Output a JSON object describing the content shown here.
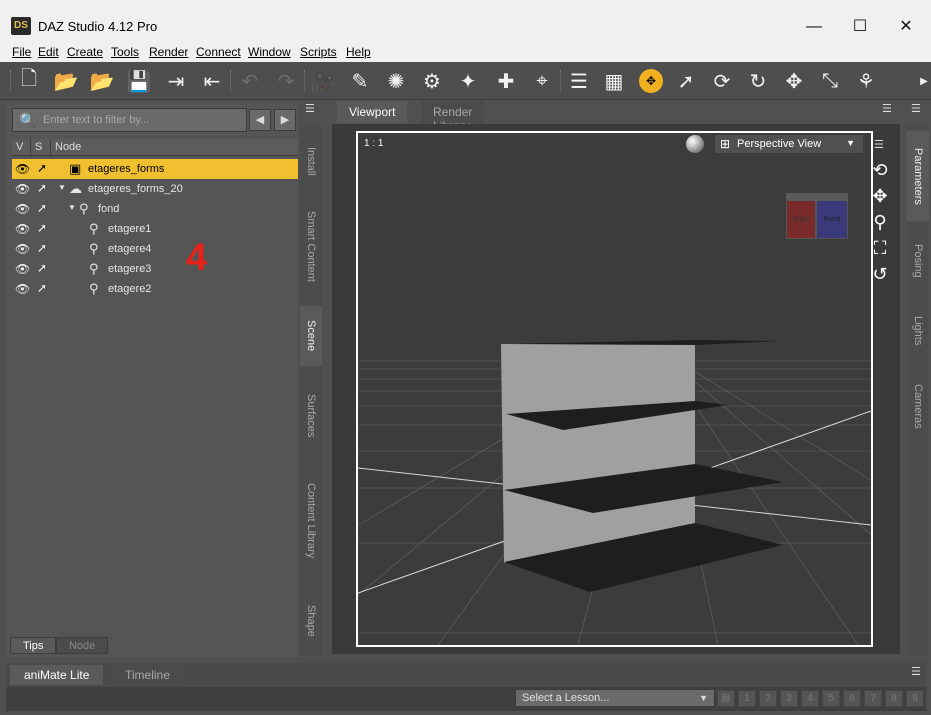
{
  "window": {
    "title": "DAZ Studio 4.12 Pro",
    "icon_text": "DS",
    "minimize": "—",
    "maximize": "☐",
    "close": "✕"
  },
  "menu": [
    "File",
    "Edit",
    "Create",
    "Tools",
    "Render",
    "Connect",
    "Window",
    "Scripts",
    "Help"
  ],
  "toolbar": {
    "icons": [
      "new-icon",
      "open-icon",
      "merge-icon",
      "save-icon",
      "import-icon",
      "export-icon",
      "undo-icon",
      "redo-icon",
      "scene-tool-icon",
      "spot-render-icon",
      "render-icon",
      "render-settings-icon",
      "light-icon",
      "camera-icon",
      "node-tool-icon",
      "align-icon",
      "grid-icon",
      "universal-tool-icon",
      "node-selection-icon",
      "transform-icon",
      "rotate-icon",
      "translate-icon",
      "scale-icon",
      "joint-editor-icon",
      "more-icon"
    ]
  },
  "scene_pane": {
    "filter_placeholder": "Enter text to filter by...",
    "columns": {
      "v": "V",
      "s": "S",
      "node": "Node"
    },
    "nodes": [
      {
        "label": "etageres_forms",
        "level": 0,
        "selected": true,
        "type": "object",
        "expanded": null
      },
      {
        "label": "etageres_forms_20",
        "level": 0,
        "selected": false,
        "type": "figure",
        "expanded": true
      },
      {
        "label": "fond",
        "level": 1,
        "selected": false,
        "type": "bone",
        "expanded": true
      },
      {
        "label": "etagere1",
        "level": 2,
        "selected": false,
        "type": "bone",
        "expanded": null
      },
      {
        "label": "etagere4",
        "level": 2,
        "selected": false,
        "type": "bone",
        "expanded": null
      },
      {
        "label": "etagere3",
        "level": 2,
        "selected": false,
        "type": "bone",
        "expanded": null
      },
      {
        "label": "etagere2",
        "level": 2,
        "selected": false,
        "type": "bone",
        "expanded": null
      }
    ],
    "annotation": "4",
    "bottom_tabs": [
      "Tips",
      "Node"
    ]
  },
  "left_side_tabs": [
    "Install",
    "Smart Content",
    "Scene",
    "Surfaces",
    "Content Library",
    "Shape"
  ],
  "left_side_active": "Scene",
  "right_side_tabs": [
    "Parameters",
    "Posing",
    "Lights",
    "Cameras"
  ],
  "right_side_active": "Parameters",
  "viewport": {
    "tabs": [
      "Viewport",
      "Render Library"
    ],
    "ratio": "1 : 1",
    "view": "Perspective View",
    "cube_labels": {
      "left": "Right",
      "right": "Front"
    }
  },
  "animate": {
    "tabs": [
      "aniMate Lite",
      "Timeline"
    ],
    "lesson_placeholder": "Select a Lesson...",
    "steps": [
      "1",
      "2",
      "3",
      "4",
      "5",
      "6",
      "7",
      "8",
      "9"
    ]
  },
  "colors": {
    "selection": "#f0c030",
    "annotation": "#e8211a",
    "panel": "#555555"
  }
}
